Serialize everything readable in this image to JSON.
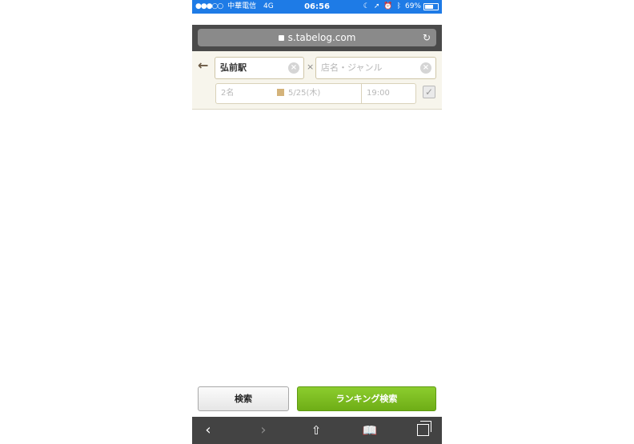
{
  "status_bar": {
    "signal": "●●●○○",
    "carrier": "中華電信",
    "network": "4G",
    "time": "06:56",
    "battery": "69%",
    "battery_level": 0.69
  },
  "browser": {
    "url": "s.tabelog.com"
  },
  "search": {
    "area_value": "弘前駅",
    "keyword_placeholder": "店名・ジャンル",
    "separator": "×",
    "clear_glyph": "×",
    "people": "2名",
    "date": "5/25(木)",
    "time": "19:00"
  },
  "buttons": {
    "search_label": "検索",
    "ranking_label": "ランキング検索"
  },
  "colors": {
    "status_bar": "#1e7be6",
    "ranking_button": "#7abe22",
    "header_bg": "#f7f5ec"
  }
}
